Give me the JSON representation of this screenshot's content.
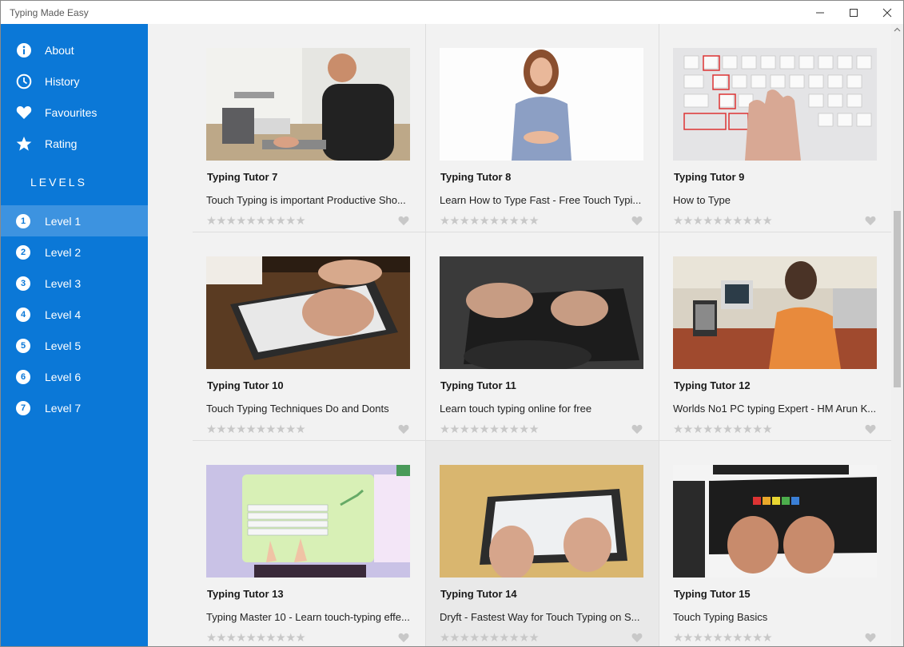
{
  "window": {
    "title": "Typing Made Easy"
  },
  "sidebar": {
    "items": [
      {
        "label": "About",
        "icon": "info-icon"
      },
      {
        "label": "History",
        "icon": "clock-icon"
      },
      {
        "label": "Favourites",
        "icon": "heart-icon"
      },
      {
        "label": "Rating",
        "icon": "star-icon"
      }
    ],
    "levels_heading": "LEVELS",
    "levels": [
      {
        "num": "1",
        "label": "Level 1",
        "selected": true
      },
      {
        "num": "2",
        "label": "Level 2"
      },
      {
        "num": "3",
        "label": "Level 3"
      },
      {
        "num": "4",
        "label": "Level 4"
      },
      {
        "num": "5",
        "label": "Level 5"
      },
      {
        "num": "6",
        "label": "Level 6"
      },
      {
        "num": "7",
        "label": "Level 7"
      }
    ]
  },
  "videos": [
    {
      "title": "Typing Tutor 7",
      "description": "Touch Typing is important Productive Sho...",
      "rating": 0
    },
    {
      "title": "Typing Tutor 8",
      "description": "Learn How to Type Fast - Free Touch Typi...",
      "rating": 0
    },
    {
      "title": "Typing Tutor 9",
      "description": "How to Type",
      "rating": 0
    },
    {
      "title": "Typing Tutor 10",
      "description": "Touch Typing Techniques Do and Donts",
      "rating": 0
    },
    {
      "title": "Typing Tutor 11",
      "description": "Learn touch typing online for free",
      "rating": 0
    },
    {
      "title": "Typing Tutor 12",
      "description": "Worlds No1 PC typing Expert - HM Arun K...",
      "rating": 0
    },
    {
      "title": "Typing Tutor 13",
      "description": "Typing Master 10 - Learn touch-typing effe...",
      "rating": 0
    },
    {
      "title": "Typing Tutor 14",
      "description": "Dryft - Fastest Way for Touch Typing on S...",
      "rating": 0
    },
    {
      "title": "Typing Tutor 15",
      "description": "Touch Typing Basics",
      "rating": 0
    }
  ],
  "rating_stars": "★★★★★★★★★★",
  "colors": {
    "sidebar": "#0b78d7",
    "selected_level": "#3d93e0",
    "content_bg": "#f2f2f2",
    "star_empty": "#c8c8c8"
  }
}
